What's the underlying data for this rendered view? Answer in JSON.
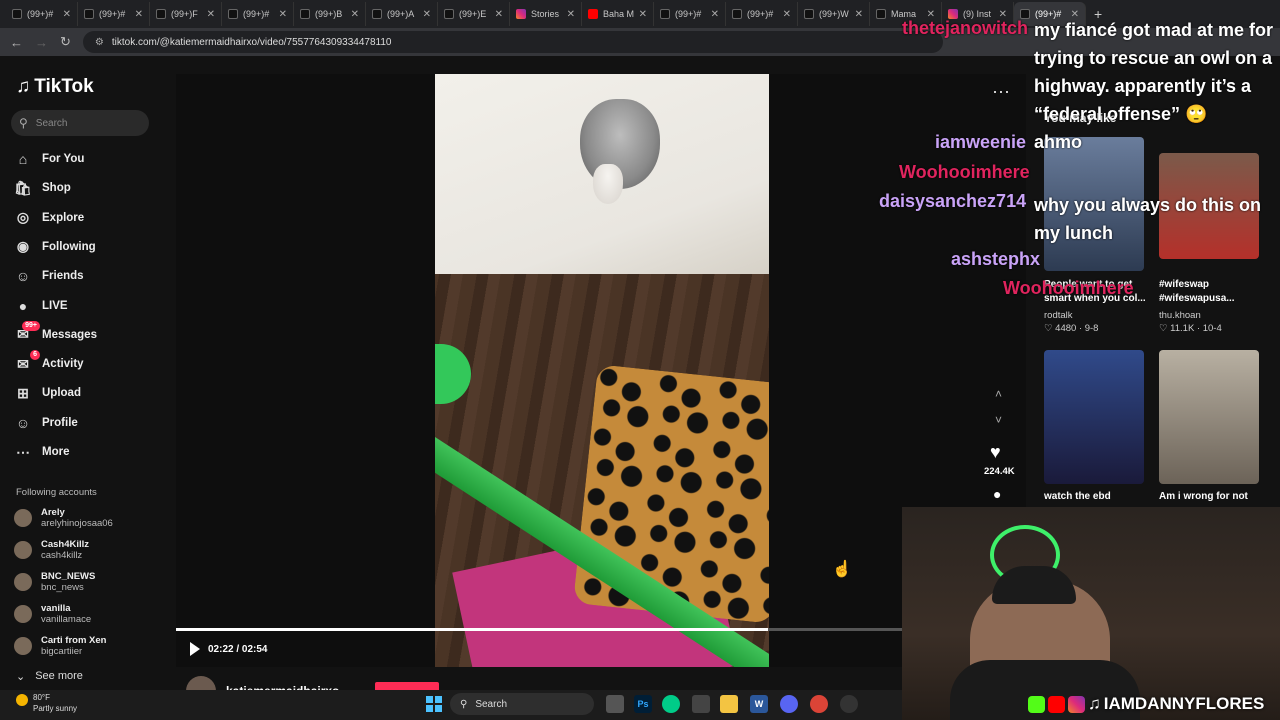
{
  "browser": {
    "tabs": [
      {
        "label": "(99+)#",
        "icon": "tiktok"
      },
      {
        "label": "(99+)#",
        "icon": "tiktok"
      },
      {
        "label": "(99+)F",
        "icon": "tiktok"
      },
      {
        "label": "(99+)#",
        "icon": "tiktok"
      },
      {
        "label": "(99+)B",
        "icon": "tiktok"
      },
      {
        "label": "(99+)A",
        "icon": "tiktok"
      },
      {
        "label": "(99+)E",
        "icon": "tiktok"
      },
      {
        "label": "Stories",
        "icon": "instagram"
      },
      {
        "label": "Baha M",
        "icon": "youtube"
      },
      {
        "label": "(99+)#",
        "icon": "tiktok"
      },
      {
        "label": "(99+)#",
        "icon": "tiktok"
      },
      {
        "label": "(99+)W",
        "icon": "tiktok"
      },
      {
        "label": "Mama",
        "icon": "tiktok"
      },
      {
        "label": "(9) Inst",
        "icon": "instagram"
      },
      {
        "label": "(99+)#",
        "icon": "tiktok",
        "active": true
      }
    ],
    "url": "tiktok.com/@katiemermaidhairxo/video/7557764309334478110"
  },
  "sidebar": {
    "logo": "TikTok",
    "search_placeholder": "Search",
    "nav": [
      {
        "label": "For You",
        "icon": "home-icon"
      },
      {
        "label": "Shop",
        "icon": "shop-icon"
      },
      {
        "label": "Explore",
        "icon": "compass-icon"
      },
      {
        "label": "Following",
        "icon": "following-avatar-icon"
      },
      {
        "label": "Friends",
        "icon": "friends-icon"
      },
      {
        "label": "LIVE",
        "icon": "live-icon"
      },
      {
        "label": "Messages",
        "icon": "messages-icon",
        "badge": "99+"
      },
      {
        "label": "Activity",
        "icon": "activity-icon",
        "badge": "6"
      },
      {
        "label": "Upload",
        "icon": "upload-icon"
      },
      {
        "label": "Profile",
        "icon": "profile-icon"
      },
      {
        "label": "More",
        "icon": "more-icon"
      }
    ],
    "following_title": "Following accounts",
    "accounts": [
      {
        "name": "Arely",
        "handle": "arelyhinojosaa06"
      },
      {
        "name": "Cash4Killz",
        "handle": "cash4killz"
      },
      {
        "name": "BNC_NEWS",
        "handle": "bnc_news"
      },
      {
        "name": "vanilla",
        "handle": "vanillamace"
      },
      {
        "name": "Carti from Xen",
        "handle": "bigcartiier"
      }
    ],
    "see_more": "See more"
  },
  "player": {
    "time": "02:22 / 02:54",
    "progress": 0.8161,
    "author": "katiemermaidhairxo",
    "likes": "224.4K"
  },
  "chat_overlay": {
    "usernames": [
      {
        "name": "thetejanowitch",
        "color": "#e0245e"
      },
      {
        "name": "iamweenie",
        "color": "#c9a3f7"
      },
      {
        "name": "Woohooimhere",
        "color": "#e0245e"
      },
      {
        "name": "daisysanchez714",
        "color": "#c9a3f7"
      },
      {
        "name": "ashstephx",
        "color": "#c9a3f7"
      },
      {
        "name": "Woohooimhere",
        "color": "#e0245e"
      }
    ],
    "messages": [
      "my fiancé got mad at me for trying to rescue an owl on a highway. apparently it’s a “federal offense” 🙄",
      "ahmo",
      "why you always do this on my lunch"
    ]
  },
  "you_may_like": {
    "title": "You may like",
    "items": [
      {
        "caption": "People want to get smart when you col...",
        "user": "rodtalk",
        "stats": "4480 · 9-8"
      },
      {
        "caption": "#wifeswap #wifeswapusa...",
        "user": "thu.khoan",
        "stats": "11.1K · 10-4"
      },
      {
        "caption": "watch the ebd",
        "user": "",
        "stats": ""
      },
      {
        "caption": "Am i wrong for not",
        "user": "",
        "stats": ""
      }
    ]
  },
  "stream": {
    "handle": "IAMDANNYFLORES"
  },
  "taskbar": {
    "temperature": "80°F",
    "weather": "Partly sunny",
    "search_label": "Search"
  }
}
